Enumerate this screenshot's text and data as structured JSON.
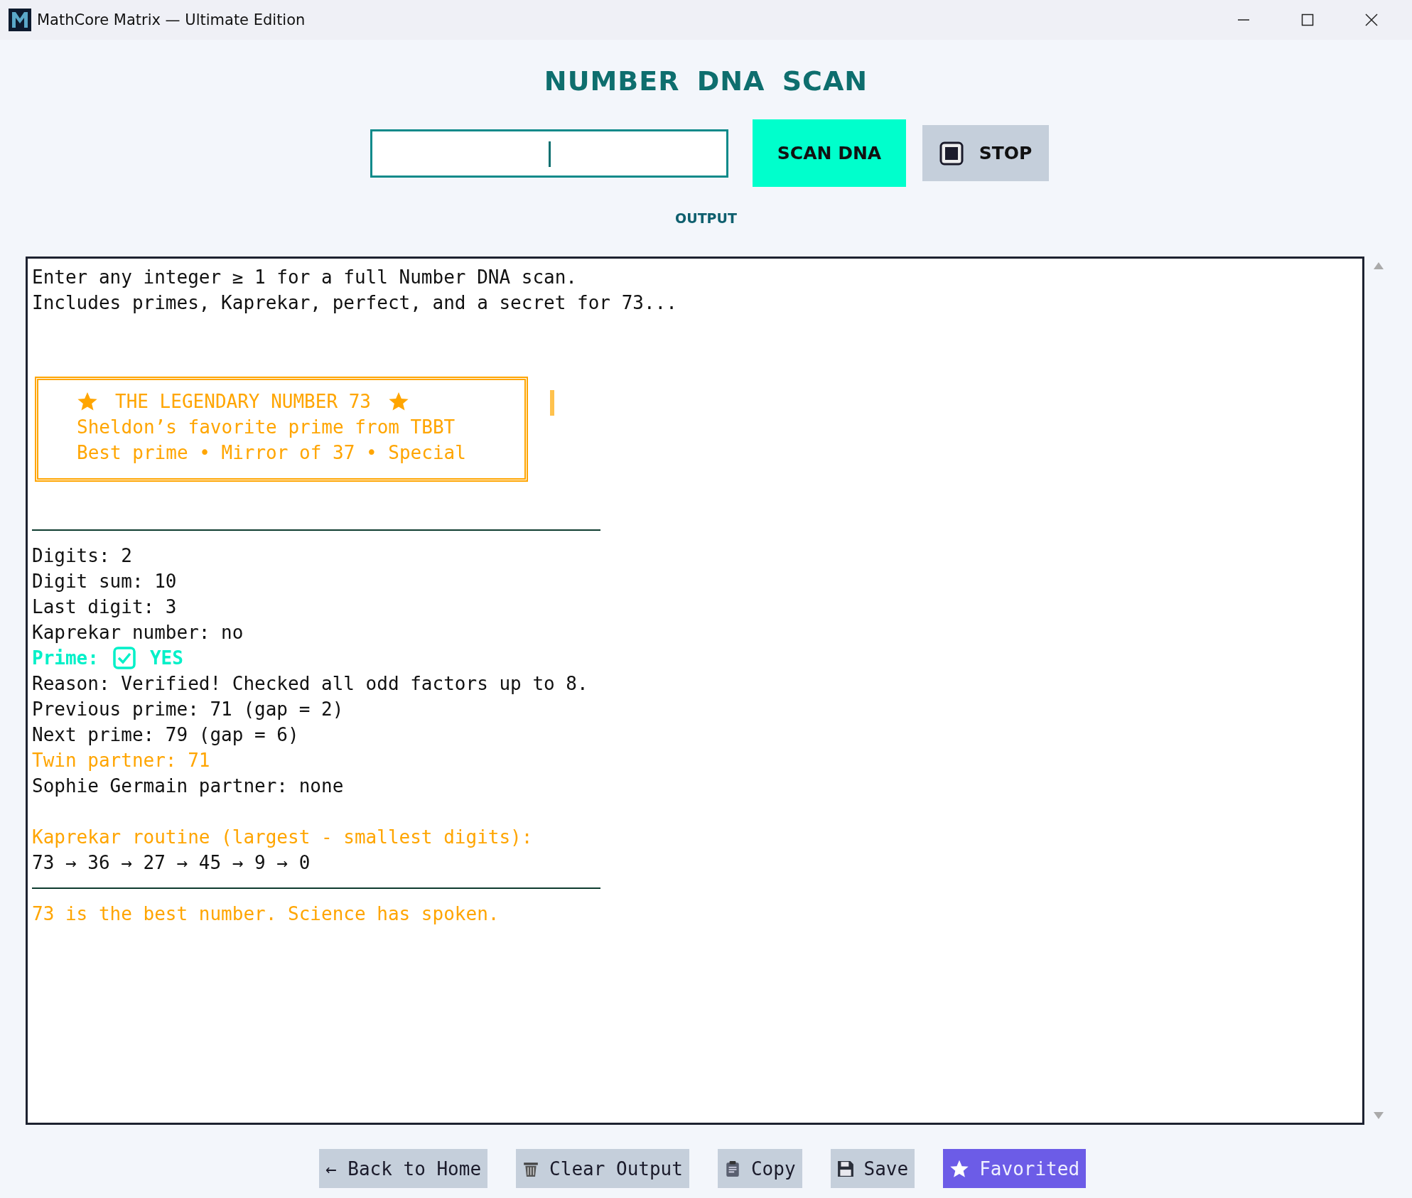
{
  "window": {
    "title": "MathCore Matrix — Ultimate Edition"
  },
  "heading": "NUMBER DNA SCAN",
  "scan_buttons": [
    {
      "label": "SCAN DNA",
      "kind": "primary"
    },
    {
      "label": "STOP",
      "kind": "stop"
    }
  ],
  "output": {
    "label": "OUTPUT",
    "lines": [
      {
        "kind": "text",
        "text": "Enter any integer ≥ 1 for a full Number DNA scan."
      },
      {
        "kind": "text",
        "text": "Includes primes, Kaprekar, perfect, and a secret for 73..."
      },
      {
        "kind": "spacer"
      },
      {
        "kind": "spacer"
      },
      {
        "kind": "banner",
        "title": "THE LEGENDARY NUMBER 73",
        "lines": [
          "Sheldon’s favorite prime from TBBT",
          "Best prime • Mirror of 37 • Special"
        ]
      },
      {
        "kind": "spacer"
      },
      {
        "kind": "rule"
      },
      {
        "kind": "text",
        "text": "Digits: 2"
      },
      {
        "kind": "text",
        "text": "Digit sum: 10"
      },
      {
        "kind": "text",
        "text": "Last digit: 3"
      },
      {
        "kind": "text",
        "text": "Kaprekar number: no"
      },
      {
        "kind": "status",
        "label": "Prime:",
        "value": "YES",
        "checked": true
      },
      {
        "kind": "text",
        "text": "Reason: Verified! Checked all odd factors up to 8."
      },
      {
        "kind": "text",
        "text": "Previous prime: 71 (gap = 2)"
      },
      {
        "kind": "text",
        "text": "Next prime: 79 (gap = 6)"
      },
      {
        "kind": "accent",
        "text": "Twin partner: 71"
      },
      {
        "kind": "text",
        "text": "Sophie Germain partner: none"
      },
      {
        "kind": "spacer"
      },
      {
        "kind": "accent",
        "text": "Kaprekar routine (largest - smallest digits):"
      },
      {
        "kind": "text",
        "text": "73 → 36 → 27 → 45 → 9 → 0"
      },
      {
        "kind": "rule"
      },
      {
        "kind": "accent",
        "text": "73 is the best number. Science has spoken."
      }
    ]
  },
  "actions": [
    {
      "label": "← Back to Home",
      "kind": "back",
      "on": false
    },
    {
      "label": "Clear Output",
      "kind": "clear",
      "on": false
    },
    {
      "label": "Copy",
      "kind": "copy",
      "on": false
    },
    {
      "label": "Save",
      "kind": "save",
      "on": false
    },
    {
      "label": "Favorited",
      "kind": "favorite",
      "on": true
    }
  ]
}
